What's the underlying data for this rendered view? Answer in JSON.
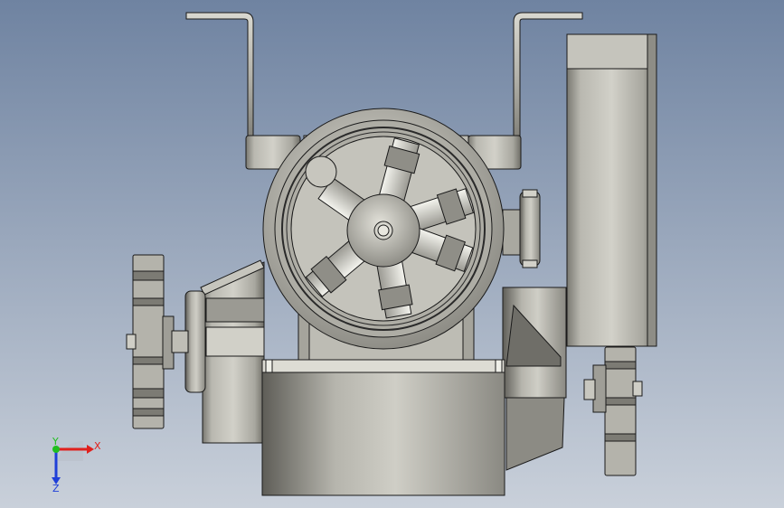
{
  "viewport": {
    "background_top": "#6f83a1",
    "background_bottom": "#c7ced8"
  },
  "model": {
    "name": "",
    "shade_light": "#d4d3cb",
    "shade_mid": "#a9a8a0",
    "shade_dark": "#6b6a64",
    "edge": "#1a1a1a"
  },
  "triad": {
    "x_label": "X",
    "y_label": "Y",
    "z_label": "Z",
    "x_color": "#e0201c",
    "y_color": "#1fbf1f",
    "z_color": "#1f3fd8"
  }
}
